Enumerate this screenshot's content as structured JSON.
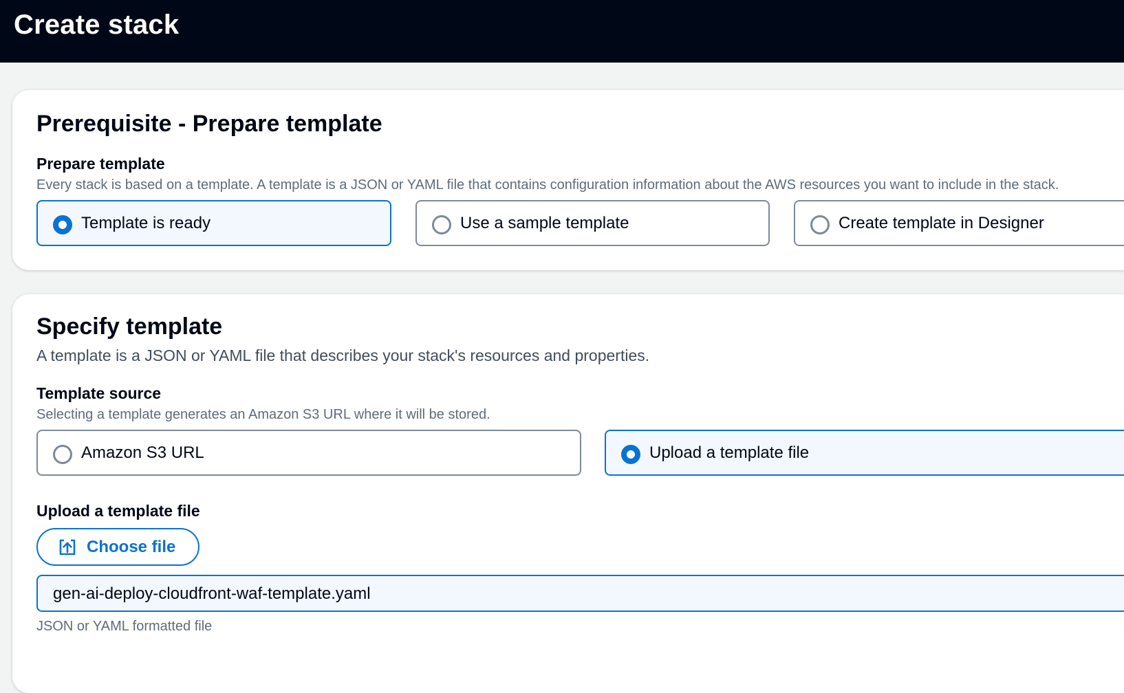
{
  "header": {
    "title": "Create stack"
  },
  "prerequisite": {
    "title": "Prerequisite - Prepare template",
    "field_label": "Prepare template",
    "description": "Every stack is based on a template. A template is a JSON or YAML file that contains configuration information about the AWS resources you want to include in the stack.",
    "options": [
      {
        "label": "Template is ready",
        "selected": true
      },
      {
        "label": "Use a sample template",
        "selected": false
      },
      {
        "label": "Create template in Designer",
        "selected": false
      }
    ]
  },
  "specify": {
    "title": "Specify template",
    "description": "A template is a JSON or YAML file that describes your stack's resources and properties.",
    "source_label": "Template source",
    "source_description": "Selecting a template generates an Amazon S3 URL where it will be stored.",
    "source_options": [
      {
        "label": "Amazon S3 URL",
        "selected": false
      },
      {
        "label": "Upload a template file",
        "selected": true
      }
    ],
    "upload_label": "Upload a template file",
    "choose_file_label": "Choose file",
    "file_name": "gen-ai-deploy-cloudfront-waf-template.yaml",
    "file_hint": "JSON or YAML formatted file"
  },
  "icons": {
    "radio_selected": "radio-selected-icon",
    "radio_unselected": "radio-unselected-icon",
    "upload": "upload-icon"
  },
  "colors": {
    "header_bg": "#000716",
    "accent": "#0972d3",
    "selected_tile_bg": "#f2f8fd",
    "border_gray": "#7d8998",
    "muted_text": "#5f6b7a"
  }
}
